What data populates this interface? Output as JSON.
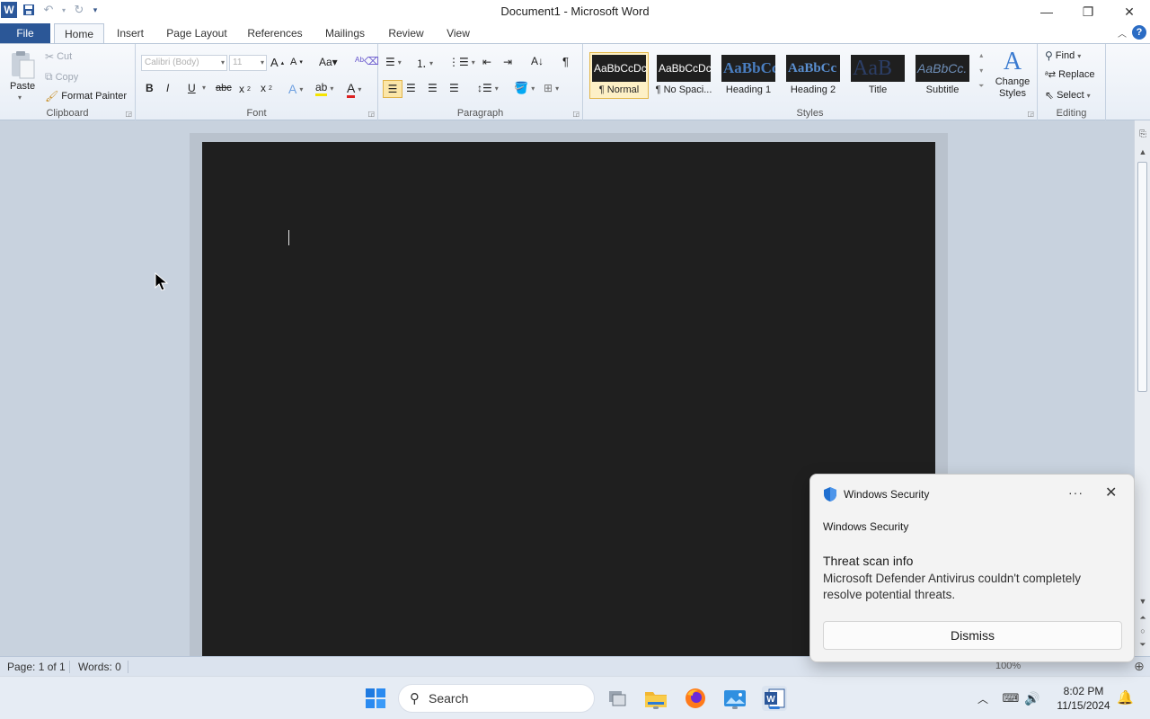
{
  "window": {
    "title": "Document1 - Microsoft Word",
    "app_icon_letter": "W"
  },
  "tabs": [
    {
      "label": "File"
    },
    {
      "label": "Home"
    },
    {
      "label": "Insert"
    },
    {
      "label": "Page Layout"
    },
    {
      "label": "References"
    },
    {
      "label": "Mailings"
    },
    {
      "label": "Review"
    },
    {
      "label": "View"
    }
  ],
  "active_tab": "Home",
  "ribbon": {
    "clipboard": {
      "label": "Clipboard",
      "paste": "Paste",
      "cut": "Cut",
      "copy": "Copy",
      "format_painter": "Format Painter"
    },
    "font": {
      "label": "Font",
      "font_name": "Calibri (Body)",
      "font_size": "11"
    },
    "paragraph": {
      "label": "Paragraph"
    },
    "styles": {
      "label": "Styles",
      "tiles": [
        {
          "preview": "AaBbCcDc",
          "name": "¶ Normal",
          "selected": true
        },
        {
          "preview": "AaBbCcDc",
          "name": "¶ No Spaci...",
          "selected": false
        },
        {
          "preview": "AaBbCc",
          "name": "Heading 1",
          "selected": false
        },
        {
          "preview": "AaBbCc",
          "name": "Heading 2",
          "selected": false
        },
        {
          "preview": "AaB",
          "name": "Title",
          "selected": false
        },
        {
          "preview": "AaBbCc.",
          "name": "Subtitle",
          "selected": false
        }
      ],
      "change_styles": "Change Styles"
    },
    "editing": {
      "label": "Editing",
      "find": "Find",
      "replace": "Replace",
      "select": "Select"
    }
  },
  "statusbar": {
    "page": "Page: 1 of 1",
    "words": "Words: 0",
    "zoom": "100%"
  },
  "taskbar": {
    "search_placeholder": "Search",
    "time": "8:02 PM",
    "date": "11/15/2024"
  },
  "toast": {
    "app_name": "Windows Security",
    "source": "Windows Security",
    "title": "Threat scan info",
    "body": "Microsoft Defender Antivirus couldn't completely resolve potential threats.",
    "button": "Dismiss"
  },
  "colors": {
    "accent": "#2b5797",
    "page_background": "#1f1f1f",
    "style_selected": "#fdf0c6"
  }
}
